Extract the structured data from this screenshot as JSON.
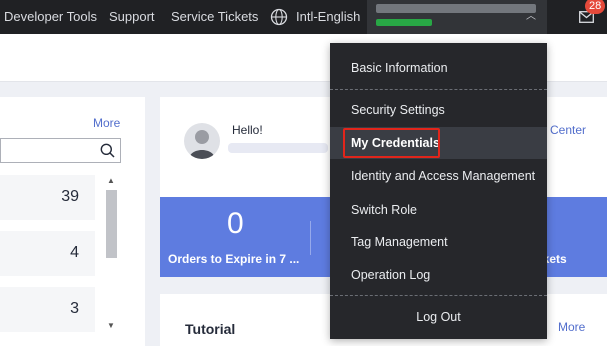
{
  "topnav": {
    "developer_tools": "Developer Tools",
    "support": "Support",
    "service_tickets": "Service Tickets",
    "language": "Intl-English",
    "mail_count": "28"
  },
  "left_panel": {
    "more_label": "More",
    "counts": [
      "39",
      "4",
      "3"
    ]
  },
  "welcome": {
    "greeting": "Hello!",
    "center_link": "Center"
  },
  "stats": {
    "orders_count": "0",
    "orders_label": "Orders to Expire in 7 ...",
    "tickets_label": "ckets"
  },
  "tutorial": {
    "title": "Tutorial",
    "more_label": "More"
  },
  "account_menu": {
    "items": [
      "Basic Information",
      "Security Settings",
      "My Credentials",
      "Identity and Access Management",
      "Switch Role",
      "Tag Management",
      "Operation Log",
      "Log Out"
    ]
  },
  "colors": {
    "nav_bg": "#202124",
    "accent_blue": "#5e7ce0",
    "link_blue": "#526ecc",
    "highlight_red": "#e1251b",
    "badge_red": "#e5493a"
  }
}
